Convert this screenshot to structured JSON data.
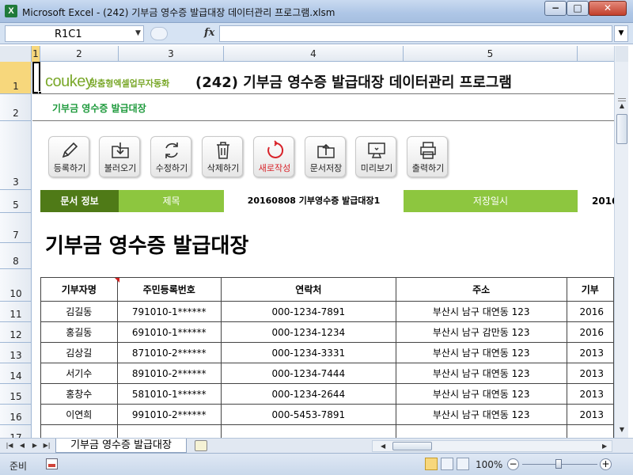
{
  "window": {
    "app_icon": "X",
    "title": "Microsoft Excel - (242) 기부금 영수증 발급대장 데이터관리 프로그램.xlsm",
    "min_glyph": "−",
    "max_glyph": "□",
    "close_glyph": "✕"
  },
  "formula_bar": {
    "name_box": "R1C1",
    "fx_label": "fx",
    "formula": ""
  },
  "column_headers": [
    "1",
    "2",
    "3",
    "4",
    "5"
  ],
  "row_headers": [
    "1",
    "2",
    "3",
    "5",
    "7",
    "8",
    "10",
    "11",
    "12",
    "13",
    "14",
    "15",
    "16",
    "17"
  ],
  "header": {
    "brand": "coukey",
    "brand_sub": "맞춤형엑셀업무자동화",
    "title": "(242) 기부금 영수증 발급대장 데이터관리 프로그램",
    "subtitle": "기부금 영수증 발급대장"
  },
  "toolbar": {
    "buttons": [
      {
        "label": "등록하기",
        "icon": "pencil-icon"
      },
      {
        "label": "불러오기",
        "icon": "download-folder-icon"
      },
      {
        "label": "수정하기",
        "icon": "refresh-icon"
      },
      {
        "label": "삭제하기",
        "icon": "trash-icon"
      },
      {
        "label": "새로작성",
        "icon": "new-document-icon"
      },
      {
        "label": "문서저장",
        "icon": "upload-folder-icon"
      },
      {
        "label": "미리보기",
        "icon": "monitor-icon"
      },
      {
        "label": "출력하기",
        "icon": "printer-icon"
      }
    ]
  },
  "info_bar": {
    "label": "문서 정보",
    "title_label": "제목",
    "title_value": "20160808 기부영수증 발급대장1",
    "date_label": "저장일시",
    "date_value": "2016"
  },
  "document_title": "기부금 영수증 발급대장",
  "table": {
    "headers": [
      "기부자명",
      "주민등록번호",
      "연락처",
      "주소",
      "기부"
    ],
    "rows": [
      [
        "김길동",
        "791010-1******",
        "000-1234-7891",
        "부산시 남구 대연동 123",
        "2016"
      ],
      [
        "홍길동",
        "691010-1******",
        "000-1234-1234",
        "부산시 남구 감만동 123",
        "2016"
      ],
      [
        "김상길",
        "871010-2******",
        "000-1234-3331",
        "부산시 남구 대연동 123",
        "2013"
      ],
      [
        "서기수",
        "891010-2******",
        "000-1234-7444",
        "부산시 남구 대연동 123",
        "2013"
      ],
      [
        "홍창수",
        "581010-1******",
        "000-1234-2644",
        "부산시 남구 대연동 123",
        "2013"
      ],
      [
        "이연희",
        "991010-2******",
        "000-5453-7891",
        "부산시 남구 대연동 123",
        "2013"
      ]
    ]
  },
  "sheet_tab": "기부금 영수증 발급대장",
  "status": {
    "ready": "준비",
    "zoom": "100%",
    "zoom_out": "−",
    "zoom_in": "+",
    "zoom_level_percent": 100
  },
  "colors": {
    "brand_green": "#7aa82a",
    "info_dark_green": "#4f7a17",
    "info_light_green": "#8dc63f",
    "subtitle_green": "#1e9a3c",
    "accent_red": "#d8232a"
  }
}
